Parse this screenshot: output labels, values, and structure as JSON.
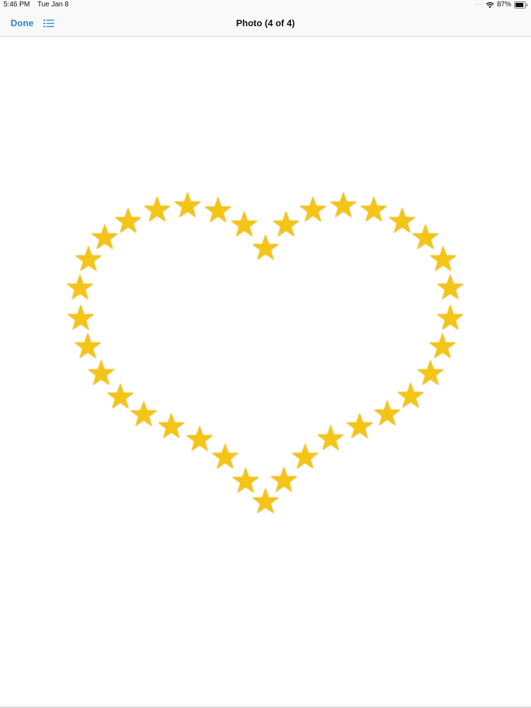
{
  "status_bar": {
    "time": "5:46 PM",
    "date": "Tue Jan 8",
    "battery_percent": "87%",
    "battery_level": 0.87
  },
  "nav": {
    "done_label": "Done",
    "list_icon": "list-icon",
    "title": "Photo (4 of 4)"
  },
  "photo": {
    "subject": "heart-of-stars",
    "star_color": "#f5c518",
    "star_edge_color": "#e9b30c"
  },
  "colors": {
    "accent": "#2f86d0",
    "nav_background": "#f9f9f9"
  }
}
